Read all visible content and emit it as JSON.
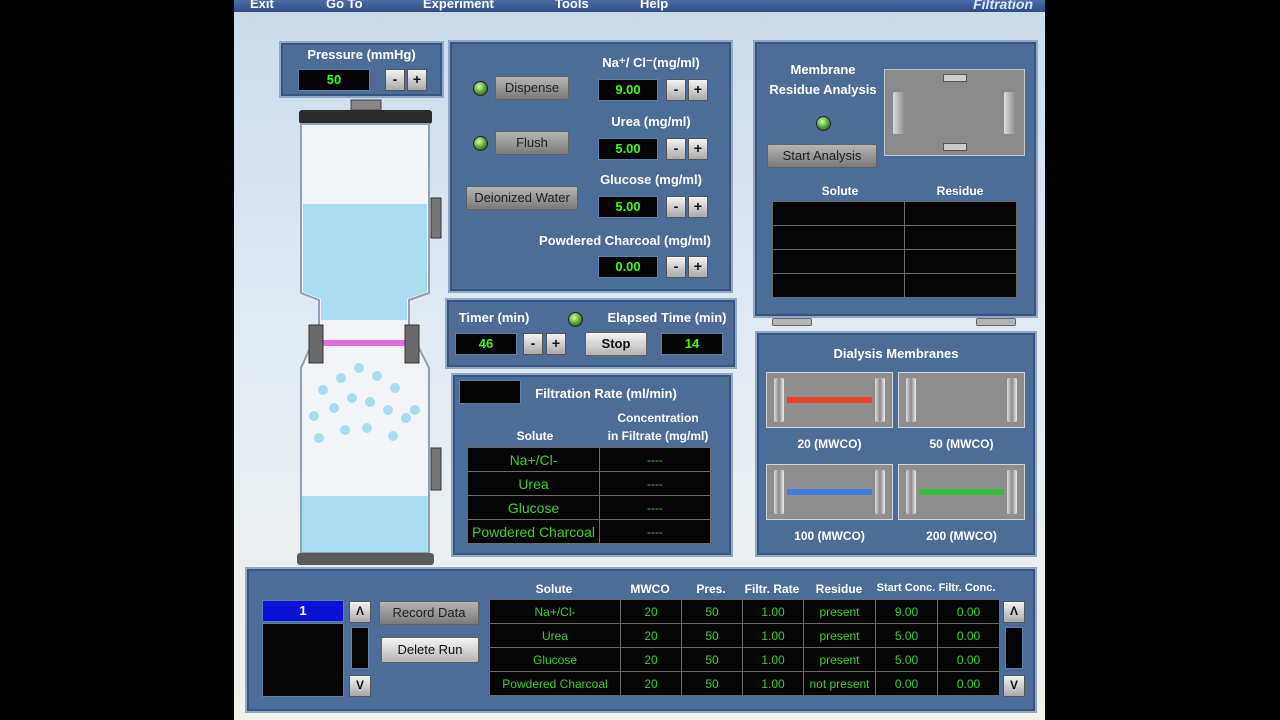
{
  "menu": {
    "items": [
      "Exit",
      "Go To",
      "Experiment",
      "Tools",
      "Help"
    ],
    "title": "Filtration"
  },
  "pressure": {
    "label": "Pressure (mmHg)",
    "value": "50",
    "minus": "-",
    "plus": "+"
  },
  "solution": {
    "dispense": "Dispense",
    "flush": "Flush",
    "deionized": "Deionized Water",
    "nacl": {
      "label": "Na⁺/ Cl⁻(mg/ml)",
      "value": "9.00"
    },
    "urea": {
      "label": "Urea (mg/ml)",
      "value": "5.00"
    },
    "glucose": {
      "label": "Glucose (mg/ml)",
      "value": "5.00"
    },
    "charcoal": {
      "label": "Powdered Charcoal (mg/ml)",
      "value": "0.00"
    },
    "minus": "-",
    "plus": "+"
  },
  "timer": {
    "label": "Timer (min)",
    "value": "46",
    "elapsed_label": "Elapsed Time (min)",
    "elapsed_value": "14",
    "stop": "Stop",
    "minus": "-",
    "plus": "+"
  },
  "filtration": {
    "title": "Filtration Rate (ml/min)",
    "col_solute": "Solute",
    "col_conc_1": "Concentration",
    "col_conc_2": "in Filtrate (mg/ml)",
    "rows": [
      {
        "solute": "Na+/Cl-",
        "conc": "----"
      },
      {
        "solute": "Urea",
        "conc": "----"
      },
      {
        "solute": "Glucose",
        "conc": "----"
      },
      {
        "solute": "Powdered Charcoal",
        "conc": "----"
      }
    ]
  },
  "membrane_analysis": {
    "title_1": "Membrane",
    "title_2": "Residue Analysis",
    "start": "Start Analysis",
    "col_solute": "Solute",
    "col_residue": "Residue"
  },
  "dialysis": {
    "title": "Dialysis Membranes",
    "items": [
      {
        "label": "20 (MWCO)",
        "color": "#e8402a"
      },
      {
        "label": "50 (MWCO)",
        "color": ""
      },
      {
        "label": "100 (MWCO)",
        "color": "#3d7fe0"
      },
      {
        "label": "200 (MWCO)",
        "color": "#2fbf3a"
      }
    ]
  },
  "records": {
    "run_number": "1",
    "record": "Record Data",
    "delete": "Delete Run",
    "up": "Λ",
    "down": "V",
    "headers": [
      "Solute",
      "MWCO",
      "Pres.",
      "Filtr. Rate",
      "Residue",
      "Start Conc.",
      "Filtr. Conc."
    ],
    "rows": [
      [
        "Na+/Cl-",
        "20",
        "50",
        "1.00",
        "present",
        "9.00",
        "0.00"
      ],
      [
        "Urea",
        "20",
        "50",
        "1.00",
        "present",
        "5.00",
        "0.00"
      ],
      [
        "Glucose",
        "20",
        "50",
        "1.00",
        "present",
        "5.00",
        "0.00"
      ],
      [
        "Powdered Charcoal",
        "20",
        "50",
        "1.00",
        "not present",
        "0.00",
        "0.00"
      ]
    ]
  },
  "colors": {
    "panel": "#4d6d99",
    "lcd_text": "#39ff14",
    "grid_text": "#39d42a"
  }
}
